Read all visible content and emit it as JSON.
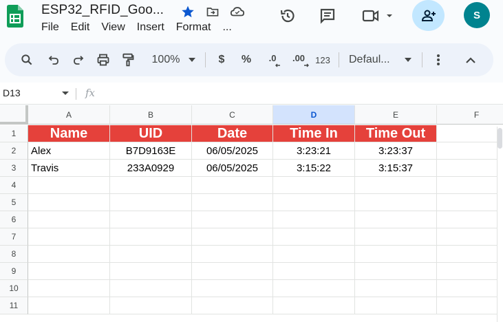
{
  "app": {
    "doc_title": "ESP32_RFID_Goo...",
    "menu": [
      "File",
      "Edit",
      "View",
      "Insert",
      "Format",
      "..."
    ],
    "avatar_initial": "S"
  },
  "toolbar": {
    "zoom": "100%",
    "currency": "$",
    "percent": "%",
    "decrease_decimal": ".0",
    "increase_decimal": ".00",
    "number_format": "123",
    "font": "Defaul..."
  },
  "formula_bar": {
    "cell_ref": "D13",
    "fx": "fx",
    "value": ""
  },
  "sheet": {
    "selected_column": "D",
    "columns": [
      "A",
      "B",
      "C",
      "D",
      "E",
      "F"
    ],
    "row_numbers": [
      "1",
      "2",
      "3",
      "4",
      "5",
      "6",
      "7",
      "8",
      "9",
      "10",
      "11"
    ],
    "headers": [
      "Name",
      "UID",
      "Date",
      "Time In",
      "Time Out"
    ],
    "header_color": "#e5413b",
    "rows": [
      [
        "Alex",
        "B7D9163E",
        "06/05/2025",
        "3:23:21",
        "3:23:37"
      ],
      [
        "Travis",
        "233A0929",
        "06/05/2025",
        "3:15:22",
        "3:15:37"
      ]
    ]
  },
  "colors": {
    "accent_blue": "#0b57d0",
    "share_bg": "#c2e7ff",
    "avatar_bg": "#00838f",
    "sheets_green": "#0f9d58"
  }
}
